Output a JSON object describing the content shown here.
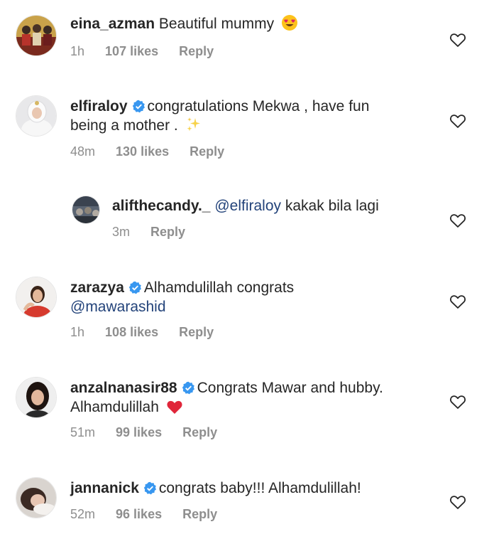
{
  "comments": [
    {
      "username": "eina_azman",
      "text": "Beautiful mummy",
      "time": "1h",
      "likes": "107 likes",
      "reply": "Reply"
    },
    {
      "username": "elfiraloy",
      "text_line1": "congratulations Mekwa , have fun",
      "text_line2": "being a mother .",
      "time": "48m",
      "likes": "130 likes",
      "reply": "Reply"
    },
    {
      "username": "alifthecandy._",
      "mention": "@elfiraloy",
      "text": "kakak bila lagi",
      "time": "3m",
      "reply": "Reply"
    },
    {
      "username": "zarazya",
      "text": "Alhamdulillah congrats",
      "mention": "@mawarashid",
      "time": "1h",
      "likes": "108 likes",
      "reply": "Reply"
    },
    {
      "username": "anzalnanasir88",
      "text_line1": "Congrats Mawar and hubby.",
      "text_line2": "Alhamdulillah",
      "time": "51m",
      "likes": "99 likes",
      "reply": "Reply"
    },
    {
      "username": "jannanick",
      "text": "congrats baby!!! Alhamdulillah!",
      "time": "52m",
      "likes": "96 likes",
      "reply": "Reply"
    }
  ],
  "colors": {
    "text": "#262626",
    "muted": "#8e8e8e",
    "mention": "#23437a",
    "verified": "#3897f0"
  },
  "icons": {
    "like": "heart-outline-icon",
    "verified": "verified-badge-icon"
  }
}
